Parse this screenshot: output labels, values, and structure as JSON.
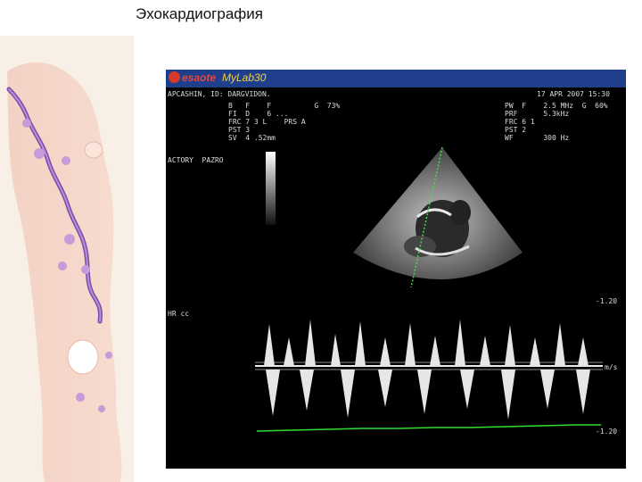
{
  "slide": {
    "title": "Эхокардиография"
  },
  "echo": {
    "brand": {
      "name": "esaote",
      "model": "MyLab30"
    },
    "header_line": {
      "patient": "APCASHIN, ID: DARGVIDON.",
      "date": "17 APR 2007 15:30"
    },
    "left_params": [
      "B   F    F          G  73%",
      "FI  D    6 ...",
      "FRC 7 3 L    PRS A",
      "PST 3",
      "SV  4 .52mm"
    ],
    "right_params": [
      "PW  F    2.5 MHz  G  60%",
      "PRF      5.3kHz",
      "FRC 6 1",
      "PST 2",
      "WF       300 Hz"
    ],
    "side_label_1": "ACTORY  PAZRO",
    "side_label_2": "HR cc",
    "scale": {
      "top": "-1.20",
      "mid": "m/s",
      "bottom": "-1.20"
    },
    "colors": {
      "background": "#000000",
      "header": "#1f3f8c",
      "trace_green": "#33dd33",
      "cursor_line": "#44dd44"
    }
  }
}
